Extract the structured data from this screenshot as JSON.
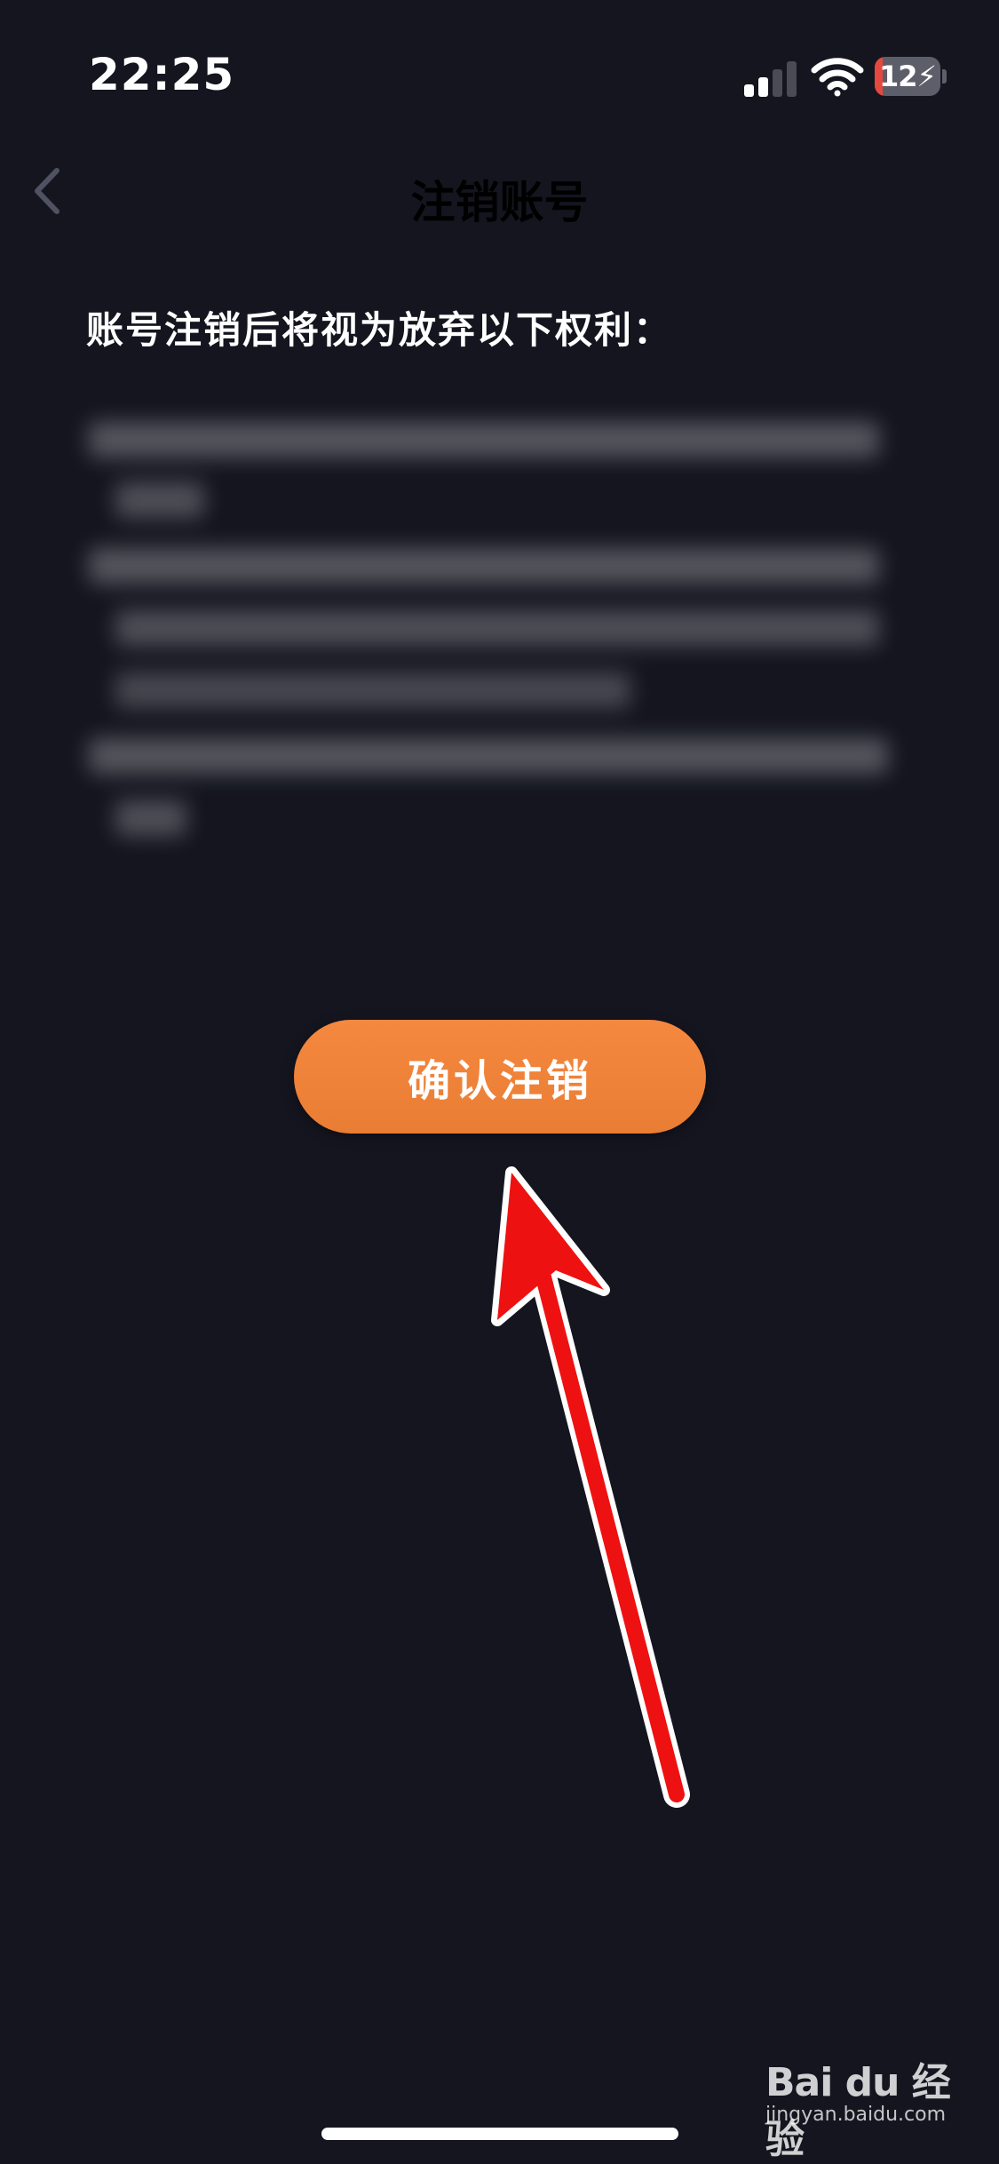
{
  "status_bar": {
    "time": "22:25",
    "battery_level": "12",
    "battery_fraction": 0.12,
    "signal_bars_active": 2,
    "signal_bars_total": 4,
    "icons": [
      "signal-icon",
      "wifi-icon",
      "battery-charging-icon"
    ]
  },
  "nav": {
    "title": "注销账号",
    "back_icon": "chevron-left-icon"
  },
  "content": {
    "intro": "账号注销后将视为放弃以下权利："
  },
  "actions": {
    "confirm_label": "确认注销"
  },
  "annotation": {
    "arrow_color": "#ee1111"
  },
  "watermark": {
    "logo_text": "Bai du 经验",
    "url": "jingyan.baidu.com"
  },
  "colors": {
    "background": "#14151f",
    "accent": "#f0823a"
  }
}
